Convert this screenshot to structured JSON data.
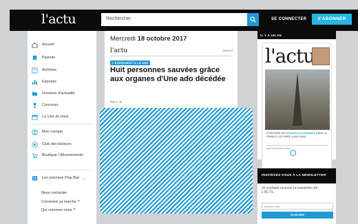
{
  "header": {
    "logo": "l'actu",
    "search_placeholder": "Rechercher",
    "connect_label": "SE CONNECTER",
    "subscribe_label": "S'ABONNER"
  },
  "sidebar": {
    "items": [
      {
        "label": "Accueil",
        "icon": "home-icon"
      },
      {
        "label": "Parents",
        "icon": "bookmark-icon"
      },
      {
        "label": "Archives",
        "icon": "archive-icon"
      },
      {
        "label": "Exposés",
        "icon": "chart-icon"
      },
      {
        "label": "Dossiers d'actualité",
        "icon": "folder-icon"
      },
      {
        "label": "Concours",
        "icon": "trophy-icon"
      },
      {
        "label": "La Une du mois",
        "icon": "calendar-icon"
      },
      {
        "label": "Mon compte",
        "icon": "user-icon"
      },
      {
        "label": "Club des lecteurs",
        "icon": "club-icon"
      },
      {
        "label": "Boutique / Abonnements",
        "icon": "cart-icon"
      },
      {
        "label": "Les journaux Play Bac",
        "icon": "newspaper-icon"
      }
    ],
    "sub_items": [
      "Nous contacter",
      "Comment ça marche ?",
      "Qui sommes-nous ?"
    ]
  },
  "article": {
    "date_prefix": "Mercredi ",
    "date_value": "18 octobre 2017",
    "mini_logo": "l'actu",
    "mini_date": "18/10/17",
    "kicker": "L'ÉVÉNEMENT À LA UNE",
    "headline": "Huit personnes sauvées grâce aux organes d'Une ado décédée",
    "byline": "Par V. R."
  },
  "aside": {
    "heading": "IL Y A UN AN",
    "cover_logo": "l'actu",
    "cover_text_prefix": "L'HISTOIRE DE ",
    "cover_text_highlight": "SOLDATS ALLEMANDS",
    "cover_text_suffix": " DANS LA FRANCE OCCUPÉE (1940-1944)",
    "cover_footer": "Mercredi 18 octobre 2016"
  },
  "newsletter": {
    "heading": "INSCRIVEZ-VOUS À LA NEWSLETTER",
    "text": "Je souhaite recevoir la newsletter de L'ACTU.",
    "email_placeholder": "Adresse email",
    "button_label": "S'INSCRIRE"
  },
  "colors": {
    "accent": "#1f9ad6",
    "topbar": "#0b0b0b",
    "page_bg": "#cfd3d6"
  }
}
